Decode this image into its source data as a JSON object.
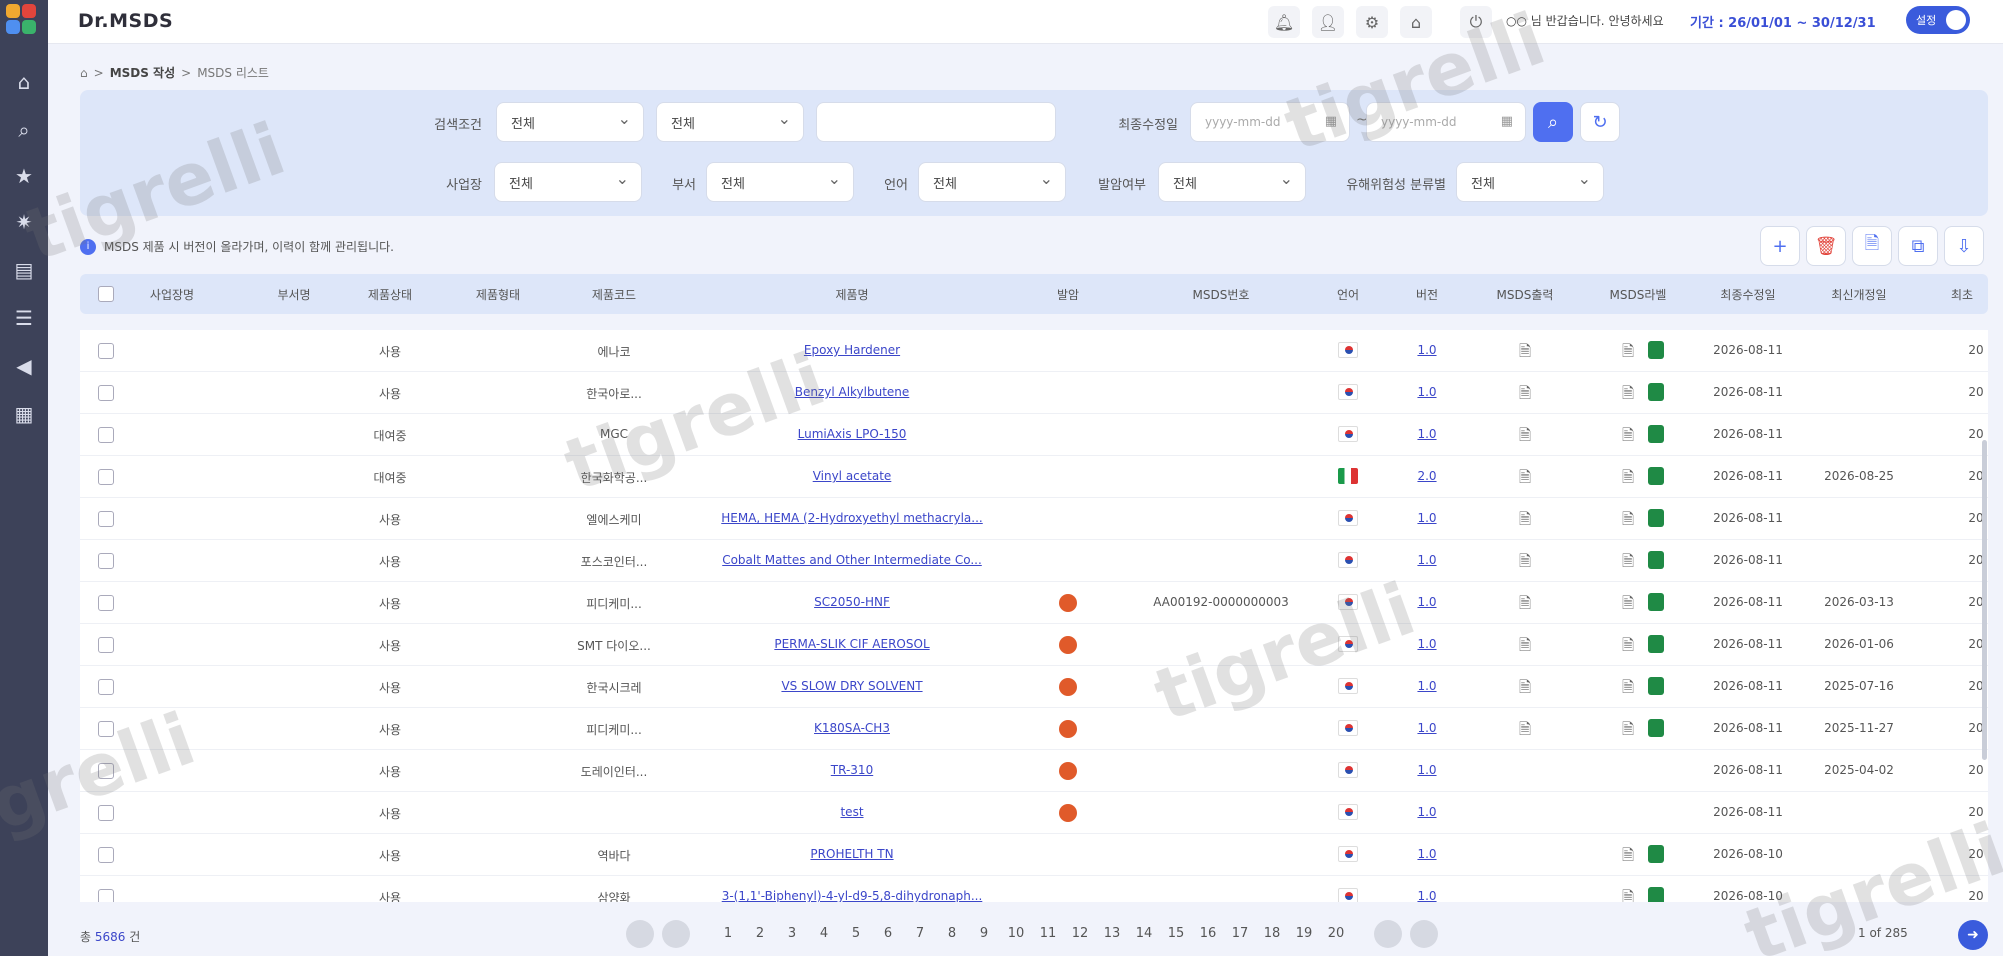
{
  "header": {
    "brand": "Dr.MSDS",
    "user_text": "○○ 님 반갑습니다. 안녕하세요",
    "period": "기간 : 26/01/01 ~ 30/12/31",
    "toggle_label": "설정"
  },
  "breadcrumb": {
    "section": "MSDS 작성",
    "page": "MSDS 리스트"
  },
  "filter": {
    "search_label": "검색조건",
    "search_sel1": "전체",
    "search_sel2": "전체",
    "search_input_placeholder": "",
    "date_label": "최종수정일",
    "date_from_placeholder": "yyyy-mm-dd",
    "date_to_placeholder": "yyyy-mm-dd",
    "site_label": "사업장",
    "site_value": "전체",
    "dept_label": "부서",
    "dept_value": "전체",
    "lang_label": "언어",
    "lang_value": "전체",
    "flag_label": "발암여부",
    "flag_value": "전체",
    "cmr_label": "유해위험성 분류별",
    "cmr_value": "전체"
  },
  "notice": "MSDS 제품 시 버전이 올라가며, 이력이 함께 관리됩니다.",
  "columns": [
    "사업장명",
    "부서명",
    "제품상태",
    "제품형태",
    "제품코드",
    "제품명",
    "발암",
    "MSDS번호",
    "언어",
    "버전",
    "MSDS출력",
    "MSDS라벨",
    "최종수정일",
    "최신개정일",
    "최초"
  ],
  "rows": [
    {
      "status": "사용",
      "code": "에나코",
      "name": "Epoxy Hardener",
      "carc": false,
      "msds_no": "",
      "lang": "kr",
      "ver": "1.0",
      "pdf": true,
      "label": true,
      "modified": "2026-08-11",
      "revised": "",
      "first": "20"
    },
    {
      "status": "사용",
      "code": "한국아로...",
      "name": "Benzyl Alkylbutene",
      "carc": false,
      "msds_no": "",
      "lang": "kr",
      "ver": "1.0",
      "pdf": true,
      "label": true,
      "modified": "2026-08-11",
      "revised": "",
      "first": "20"
    },
    {
      "status": "대여중",
      "code": "MGC",
      "name": "LumiAxis LPO-150",
      "carc": false,
      "msds_no": "",
      "lang": "kr",
      "ver": "1.0",
      "pdf": true,
      "label": true,
      "modified": "2026-08-11",
      "revised": "",
      "first": "20"
    },
    {
      "status": "대여중",
      "code": "한국화학공...",
      "name": "Vinyl acetate",
      "carc": false,
      "msds_no": "",
      "lang": "it",
      "ver": "2.0",
      "pdf": true,
      "label": true,
      "modified": "2026-08-11",
      "revised": "2026-08-25",
      "first": "20"
    },
    {
      "status": "사용",
      "code": "엘에스케미",
      "name": "HEMA, HEMA (2-Hydroxyethyl methacryla...",
      "carc": false,
      "msds_no": "",
      "lang": "kr",
      "ver": "1.0",
      "pdf": true,
      "label": true,
      "modified": "2026-08-11",
      "revised": "",
      "first": "20"
    },
    {
      "status": "사용",
      "code": "포스코인터...",
      "name": "Cobalt Mattes and Other Intermediate Co...",
      "carc": false,
      "msds_no": "",
      "lang": "kr",
      "ver": "1.0",
      "pdf": true,
      "label": true,
      "modified": "2026-08-11",
      "revised": "",
      "first": "20"
    },
    {
      "status": "사용",
      "code": "피디케미...",
      "name": "SC2050-HNF",
      "carc": true,
      "msds_no": "AA00192-0000000003",
      "lang": "kr",
      "ver": "1.0",
      "pdf": true,
      "label": true,
      "modified": "2026-08-11",
      "revised": "2026-03-13",
      "first": "20"
    },
    {
      "status": "사용",
      "code": "SMT 다이오...",
      "name": "PERMA-SLIK CIF AEROSOL",
      "carc": true,
      "msds_no": "",
      "lang": "kr",
      "ver": "1.0",
      "pdf": true,
      "label": true,
      "modified": "2026-08-11",
      "revised": "2026-01-06",
      "first": "20"
    },
    {
      "status": "사용",
      "code": "한국시크레",
      "name": "VS SLOW DRY SOLVENT",
      "carc": true,
      "msds_no": "",
      "lang": "kr",
      "ver": "1.0",
      "pdf": true,
      "label": true,
      "modified": "2026-08-11",
      "revised": "2025-07-16",
      "first": "20"
    },
    {
      "status": "사용",
      "code": "피디케미...",
      "name": "K180SA-CH3",
      "carc": true,
      "msds_no": "",
      "lang": "kr",
      "ver": "1.0",
      "pdf": true,
      "label": true,
      "modified": "2026-08-11",
      "revised": "2025-11-27",
      "first": "20"
    },
    {
      "status": "사용",
      "code": "도레이인터...",
      "name": "TR-310",
      "carc": true,
      "msds_no": "",
      "lang": "kr",
      "ver": "1.0",
      "pdf": false,
      "label": false,
      "modified": "2026-08-11",
      "revised": "2025-04-02",
      "first": "20"
    },
    {
      "status": "사용",
      "code": "",
      "name": "test",
      "carc": true,
      "msds_no": "",
      "lang": "kr",
      "ver": "1.0",
      "pdf": false,
      "label": false,
      "modified": "2026-08-11",
      "revised": "",
      "first": "20"
    },
    {
      "status": "사용",
      "code": "역바다",
      "name": "PROHELTH TN",
      "carc": false,
      "msds_no": "",
      "lang": "kr",
      "ver": "1.0",
      "pdf": false,
      "label": true,
      "modified": "2026-08-10",
      "revised": "",
      "first": "20"
    },
    {
      "status": "사용",
      "code": "삼양화",
      "name": "3-(1,1'-Biphenyl)-4-yl-d9-5,8-dihydronaph...",
      "carc": false,
      "msds_no": "",
      "lang": "kr",
      "ver": "1.0",
      "pdf": false,
      "label": true,
      "modified": "2026-08-10",
      "revised": "",
      "first": "20"
    }
  ],
  "pagination": {
    "total_prefix": "총",
    "total_count": "5686",
    "total_suffix": "건",
    "pages": [
      "1",
      "2",
      "3",
      "4",
      "5",
      "6",
      "7",
      "8",
      "9",
      "10",
      "11",
      "12",
      "13",
      "14",
      "15",
      "16",
      "17",
      "18",
      "19",
      "20"
    ],
    "summary": "1   of 285"
  },
  "watermark": "tigrelli",
  "colors": {
    "sidebar": "#3d4259",
    "accent": "#4f6ff0",
    "filter_bg": "#dde6f9",
    "link": "#3b46c9",
    "excel": "#1f8a45",
    "carcinogen": "#e05a2a"
  }
}
